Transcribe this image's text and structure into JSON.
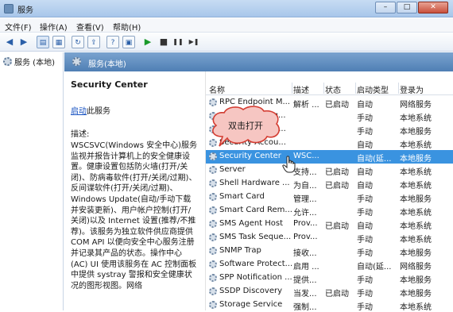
{
  "window": {
    "title": "服务",
    "controls": {
      "minimize": "–",
      "maximize": "□",
      "close": "✕"
    }
  },
  "menu": [
    "文件(F)",
    "操作(A)",
    "查看(V)",
    "帮助(H)"
  ],
  "toolbar": {
    "buttons": [
      {
        "name": "back-icon",
        "glyph": "◀"
      },
      {
        "name": "forward-icon",
        "glyph": "▶"
      },
      {
        "name": "show-tree-icon",
        "glyph": "▤"
      },
      {
        "name": "console-icon",
        "glyph": "▦"
      },
      {
        "name": "refresh-icon",
        "glyph": "↻"
      },
      {
        "name": "export-icon",
        "glyph": "⇪"
      },
      {
        "name": "help-icon",
        "glyph": "?"
      },
      {
        "name": "properties-icon",
        "glyph": "▣"
      },
      {
        "name": "start-service-icon",
        "glyph": "▶"
      },
      {
        "name": "stop-service-icon",
        "glyph": "■"
      },
      {
        "name": "pause-service-icon",
        "glyph": "❚❚"
      },
      {
        "name": "restart-service-icon",
        "glyph": "▶❚"
      }
    ]
  },
  "tree": {
    "node_label": "服务 (本地)"
  },
  "panel": {
    "header": "服务(本地)"
  },
  "details": {
    "service_name": "Security Center",
    "start_link": "启动",
    "start_suffix": "此服务",
    "description_label": "描述:",
    "description": "WSCSVC(Windows 安全中心)服务监视并报告计算机上的安全健康设置。健康设置包括防火墙(打开/关闭)、防病毒软件(打开/关闭/过期)、反间谍软件(打开/关闭/过期)、Windows Update(自动/手动下载并安装更新)、用户帐户控制(打开/关闭)以及 Internet 设置(推荐/不推荐)。该服务为独立软件供应商提供 COM API 以便向安全中心服务注册并记录其产品的状态。操作中心(AC) UI 使用该服务在 AC 控制面板中提供 systray 警报和安全健康状况的图形视图。网络"
  },
  "columns": {
    "name": "名称",
    "desc": "描述",
    "status": "状态",
    "startup": "启动类型",
    "logon": "登录为"
  },
  "rows": [
    {
      "name": "RPC Endpoint M...",
      "desc": "解析 ...",
      "status": "已启动",
      "startup": "自动",
      "logon": "网络服务"
    },
    {
      "name": "Secondary Log...",
      "desc": "",
      "status": "",
      "startup": "手动",
      "logon": "本地系统"
    },
    {
      "name": "Secure Socket ...",
      "desc": "",
      "status": "",
      "startup": "手动",
      "logon": "本地服务"
    },
    {
      "name": "Security Accou...",
      "desc": "",
      "status": "",
      "startup": "自动",
      "logon": "本地系统"
    },
    {
      "name": "Security Center",
      "desc": "WSC...",
      "status": "",
      "startup": "自动(延...",
      "logon": "本地服务"
    },
    {
      "name": "Server",
      "desc": "支持...",
      "status": "已启动",
      "startup": "自动",
      "logon": "本地系统"
    },
    {
      "name": "Shell Hardware ...",
      "desc": "为自...",
      "status": "已启动",
      "startup": "自动",
      "logon": "本地系统"
    },
    {
      "name": "Smart Card",
      "desc": "管理...",
      "status": "",
      "startup": "手动",
      "logon": "本地服务"
    },
    {
      "name": "Smart Card Rem...",
      "desc": "允许...",
      "status": "",
      "startup": "手动",
      "logon": "本地系统"
    },
    {
      "name": "SMS Agent Host",
      "desc": "Prov...",
      "status": "已启动",
      "startup": "自动",
      "logon": "本地系统"
    },
    {
      "name": "SMS Task Seque...",
      "desc": "Prov...",
      "status": "",
      "startup": "手动",
      "logon": "本地系统"
    },
    {
      "name": "SNMP Trap",
      "desc": "接收...",
      "status": "",
      "startup": "手动",
      "logon": "本地服务"
    },
    {
      "name": "Software Protect...",
      "desc": "启用 ...",
      "status": "",
      "startup": "自动(延...",
      "logon": "网络服务"
    },
    {
      "name": "SPP Notification ...",
      "desc": "提供...",
      "status": "",
      "startup": "手动",
      "logon": "本地服务"
    },
    {
      "name": "SSDP Discovery",
      "desc": "当发...",
      "status": "已启动",
      "startup": "手动",
      "logon": "本地服务"
    },
    {
      "name": "Storage Service",
      "desc": "强制...",
      "status": "",
      "startup": "手动",
      "logon": "本地系统"
    }
  ],
  "selected_row_index": 4,
  "annotation": {
    "text": "双击打开"
  },
  "colors": {
    "selection": "#3a93e0",
    "header_gradient": "#4f7fb4",
    "bubble_fill": "#f6c6c2",
    "bubble_stroke": "#d43d32"
  }
}
